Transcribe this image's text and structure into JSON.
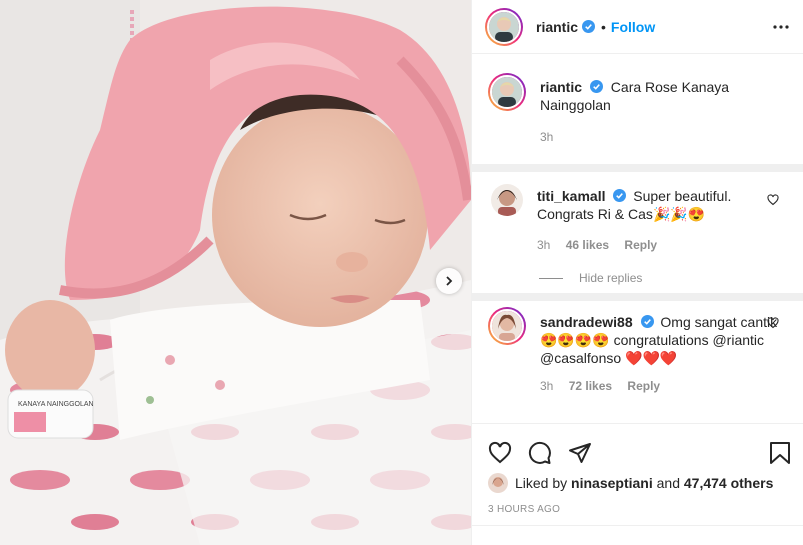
{
  "post": {
    "author": "riantic",
    "follow_label": "Follow",
    "dot": "•",
    "caption": "Cara Rose Kanaya Nainggolan",
    "caption_time": "3h",
    "wristband_text": "KANAYA NAINGGOLAN"
  },
  "comments": [
    {
      "user": "titi_kamall",
      "text": "Super beautiful. Congrats Ri & Cas",
      "emojis": "🎉🎉😍",
      "time": "3h",
      "likes": "46 likes",
      "reply": "Reply"
    },
    {
      "user": "sandradewi88",
      "text": "Omg sangat cantik",
      "emojis": "😍😍😍😍",
      "text2": "congratulations @riantic @casalfonso",
      "emojis2": "❤️❤️❤️",
      "time": "3h",
      "likes": "72 likes",
      "reply": "Reply"
    }
  ],
  "hide_replies": "Hide replies",
  "likes": {
    "prefix": "Liked by",
    "user": "ninaseptiani",
    "middle": "and",
    "others": "47,474 others"
  },
  "time_ago": "3 HOURS AGO",
  "icons": [
    "heart-icon",
    "comment-icon",
    "share-icon",
    "bookmark-icon",
    "more-icon",
    "chevron-right-icon",
    "verified-icon"
  ],
  "colors": {
    "accent": "#0095f6",
    "verified": "#3897f0",
    "text": "#262626",
    "muted": "#8e8e8e"
  }
}
